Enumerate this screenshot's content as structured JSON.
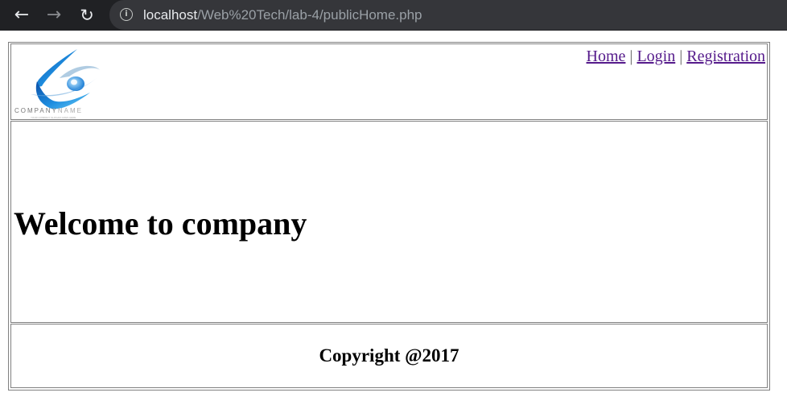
{
  "browser": {
    "url_host": "localhost",
    "url_path": "/Web%20Tech/lab-4/publicHome.php"
  },
  "header": {
    "logo": {
      "company_name_bold": "COMPANY",
      "company_name_light": "NAME",
      "tagline": "YOUR COMPANY SLOGAN GOES HERE"
    },
    "nav": {
      "home": "Home",
      "separator": "|",
      "login": "Login",
      "registration": "Registration"
    }
  },
  "main": {
    "heading": "Welcome to company"
  },
  "footer": {
    "copyright": "Copyright @2017"
  },
  "colors": {
    "link_visited": "#551a8b",
    "logo_blue": "#1e7fd6",
    "chrome_bg": "#202124"
  }
}
